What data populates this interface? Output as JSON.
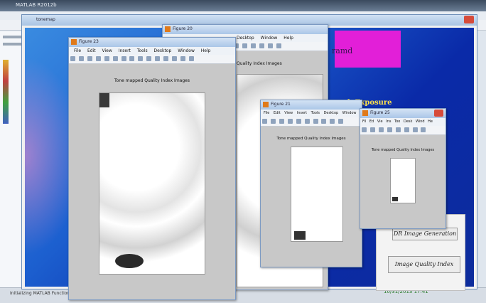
{
  "matlab": {
    "title": "MATLAB R2012b",
    "status": "Initializing MATLAB Function",
    "time": "10/31/2013 17:41"
  },
  "gui": {
    "title": "tonemap",
    "magenta_text": "ramd",
    "exposure_text": "h Exposure",
    "buttons": [
      "DR Image Generation",
      "Image Quality Index"
    ]
  },
  "figures": [
    {
      "title": "Figure 23",
      "menu": [
        "File",
        "Edit",
        "View",
        "Insert",
        "Tools",
        "Desktop",
        "Window",
        "Help"
      ],
      "caption": "Tone mapped Quality Index Images"
    },
    {
      "title": "Figure 20",
      "menu": [
        "Desktop",
        "Window",
        "Help"
      ],
      "caption": "Quality Index Images"
    },
    {
      "title": "Figure 21",
      "menu": [
        "File",
        "Edit",
        "View",
        "Insert",
        "Tools",
        "Desktop",
        "Window"
      ],
      "caption": "Tone mapped Quality Index Images"
    },
    {
      "title": "Figure 25",
      "menu": [
        "Fil",
        "Ed",
        "Vie",
        "Ins",
        "Too",
        "Desk",
        "Wind",
        "He"
      ],
      "caption": "Tone mapped Quality Index Images"
    }
  ],
  "colors": {
    "gui_bg": "#1c5fcf",
    "magenta": "#e21fd8",
    "exposure": "#ffe24a"
  }
}
